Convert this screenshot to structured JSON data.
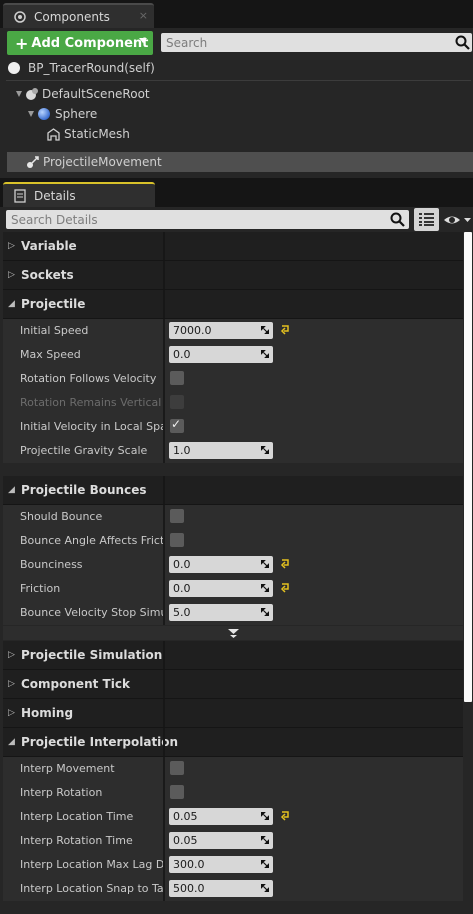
{
  "components_tab": {
    "title": "Components",
    "close": "×"
  },
  "add_component": {
    "label": "Add Component",
    "plus": "+"
  },
  "components_search": {
    "placeholder": "Search"
  },
  "root_item": {
    "label": "BP_TracerRound(self)"
  },
  "tree": [
    {
      "label": "DefaultSceneRoot",
      "icon": "scene-root-icon"
    },
    {
      "label": "Sphere",
      "icon": "sphere-icon"
    },
    {
      "label": "StaticMesh",
      "icon": "static-mesh-icon"
    },
    {
      "label": "ProjectileMovement",
      "icon": "projectile-movement-icon",
      "selected": true
    }
  ],
  "details_tab": {
    "title": "Details"
  },
  "details_search": {
    "placeholder": "Search Details"
  },
  "categories": {
    "variable": "Variable",
    "sockets": "Sockets",
    "projectile": "Projectile",
    "projectile_bounces": "Projectile Bounces",
    "projectile_simulation": "Projectile Simulation",
    "component_tick": "Component Tick",
    "homing": "Homing",
    "projectile_interpolation": "Projectile Interpolation"
  },
  "projectile": {
    "initial_speed": {
      "label": "Initial Speed",
      "value": "7000.0"
    },
    "max_speed": {
      "label": "Max Speed",
      "value": "0.0"
    },
    "rotation_follows_velocity": {
      "label": "Rotation Follows Velocity",
      "checked": false
    },
    "rotation_remains_vertical": {
      "label": "Rotation Remains Vertical",
      "checked": false
    },
    "initial_velocity_local": {
      "label": "Initial Velocity in Local Space",
      "checked": true
    },
    "gravity_scale": {
      "label": "Projectile Gravity Scale",
      "value": "1.0"
    }
  },
  "bounces": {
    "should_bounce": {
      "label": "Should Bounce",
      "checked": false
    },
    "bounce_angle_friction": {
      "label": "Bounce Angle Affects Friction",
      "checked": false
    },
    "bounciness": {
      "label": "Bounciness",
      "value": "0.0"
    },
    "friction": {
      "label": "Friction",
      "value": "0.0"
    },
    "bounce_velocity_stop": {
      "label": "Bounce Velocity Stop Simulating Threshold",
      "value": "5.0"
    }
  },
  "interpolation": {
    "interp_movement": {
      "label": "Interp Movement",
      "checked": false
    },
    "interp_rotation": {
      "label": "Interp Rotation",
      "checked": false
    },
    "interp_location_time": {
      "label": "Interp Location Time",
      "value": "0.05"
    },
    "interp_rotation_time": {
      "label": "Interp Rotation Time",
      "value": "0.05"
    },
    "interp_location_max_lag": {
      "label": "Interp Location Max Lag Distance",
      "value": "300.0"
    },
    "interp_location_snap": {
      "label": "Interp Location Snap to Target Distance",
      "value": "500.0"
    }
  },
  "colors": {
    "add_button": "#4aa845",
    "reset_arrow": "#e5c21f",
    "selected_row": "#4f4f4f"
  }
}
